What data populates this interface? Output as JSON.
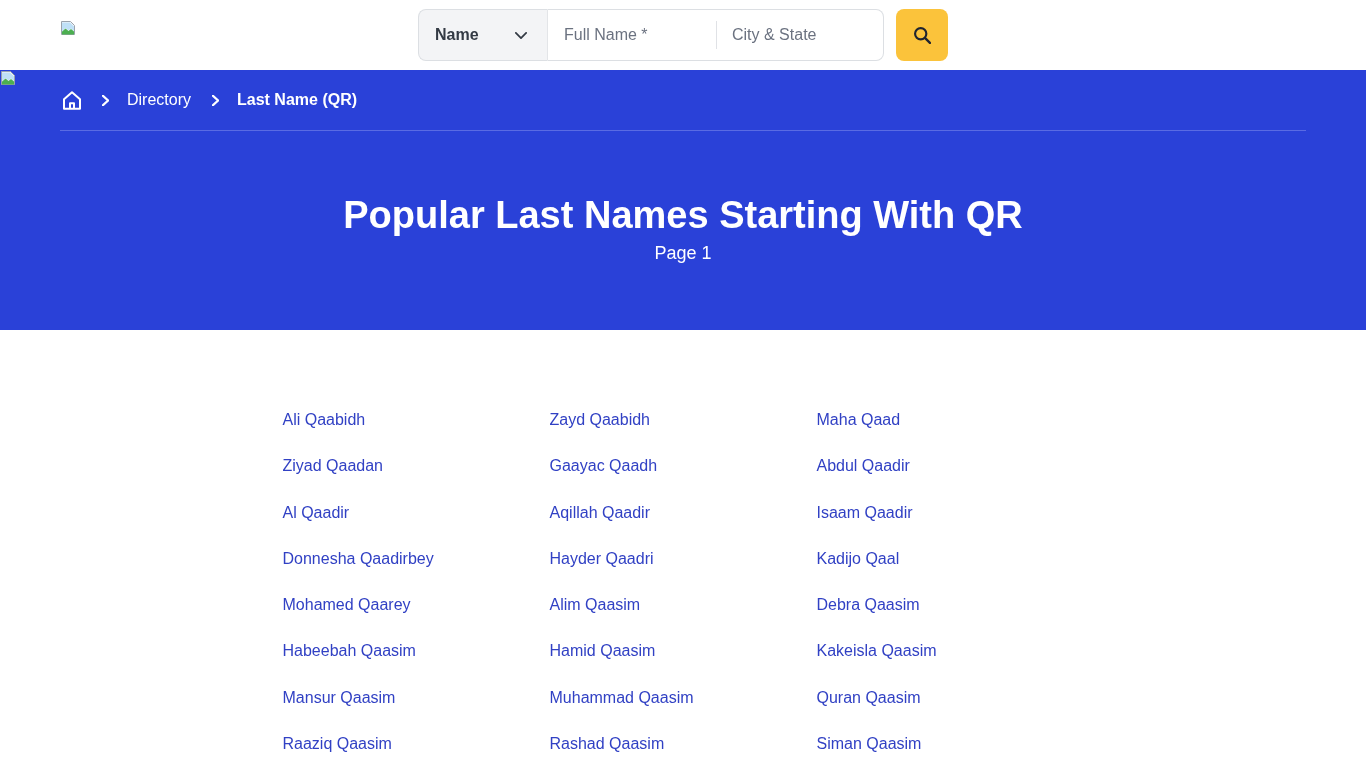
{
  "header": {
    "search": {
      "search_type": {
        "value": "Name"
      },
      "full_name": {
        "placeholder": "Full Name *"
      },
      "location": {
        "placeholder": "City & State"
      }
    }
  },
  "breadcrumb": [
    {
      "label": "Directory",
      "current": false
    },
    {
      "label": "Last Name (QR)",
      "current": true
    }
  ],
  "hero": {
    "title": "Popular Last Names Starting With QR",
    "subtitle": "Page 1"
  },
  "names": [
    "Ali Qaabidh",
    "Zayd Qaabidh",
    "Maha Qaad",
    "Ziyad Qaadan",
    "Gaayac Qaadh",
    "Abdul Qaadir",
    "Al Qaadir",
    "Aqillah Qaadir",
    "Isaam Qaadir",
    "Donnesha Qaadirbey",
    "Hayder Qaadri",
    "Kadijo Qaal",
    "Mohamed Qaarey",
    "Alim Qaasim",
    "Debra Qaasim",
    "Habeebah Qaasim",
    "Hamid Qaasim",
    "Kakeisla Qaasim",
    "Mansur Qaasim",
    "Muhammad Qaasim",
    "Quran Qaasim",
    "Raaziq Qaasim",
    "Rashad Qaasim",
    "Siman Qaasim"
  ]
}
